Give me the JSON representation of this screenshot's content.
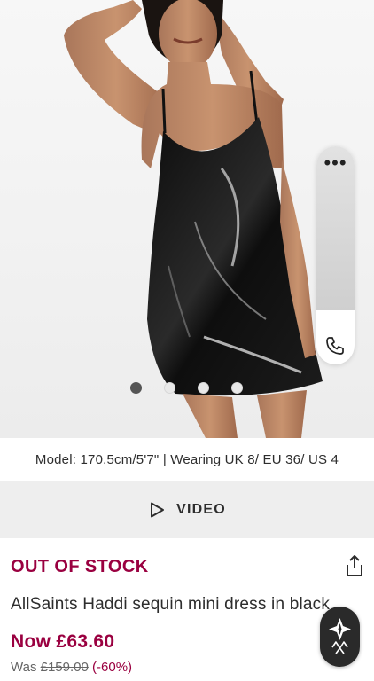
{
  "gallery": {
    "image_alt": "",
    "dots_count": 4,
    "active_dot_index": 0
  },
  "side_widget": {
    "more_icon": "more-horizontal-icon",
    "phone_icon": "phone-icon"
  },
  "model_info": "Model: 170.5cm/5'7\" | Wearing UK 8/ EU 36/ US 4",
  "video": {
    "label": "VIDEO",
    "icon": "play-icon"
  },
  "product": {
    "stock_status": "OUT OF STOCK",
    "share_icon": "share-icon",
    "title": "AllSaints Haddi sequin mini dress in black",
    "current_price": "Now £63.60",
    "was_label": "Was ",
    "was_price": "£159.00",
    "discount": "(-60%)"
  },
  "colors": {
    "accent": "#9a0040",
    "text": "#2d2d2d",
    "video_bar_bg": "#eeeeee"
  },
  "fab": {
    "icon": "assistant-logo-icon"
  }
}
